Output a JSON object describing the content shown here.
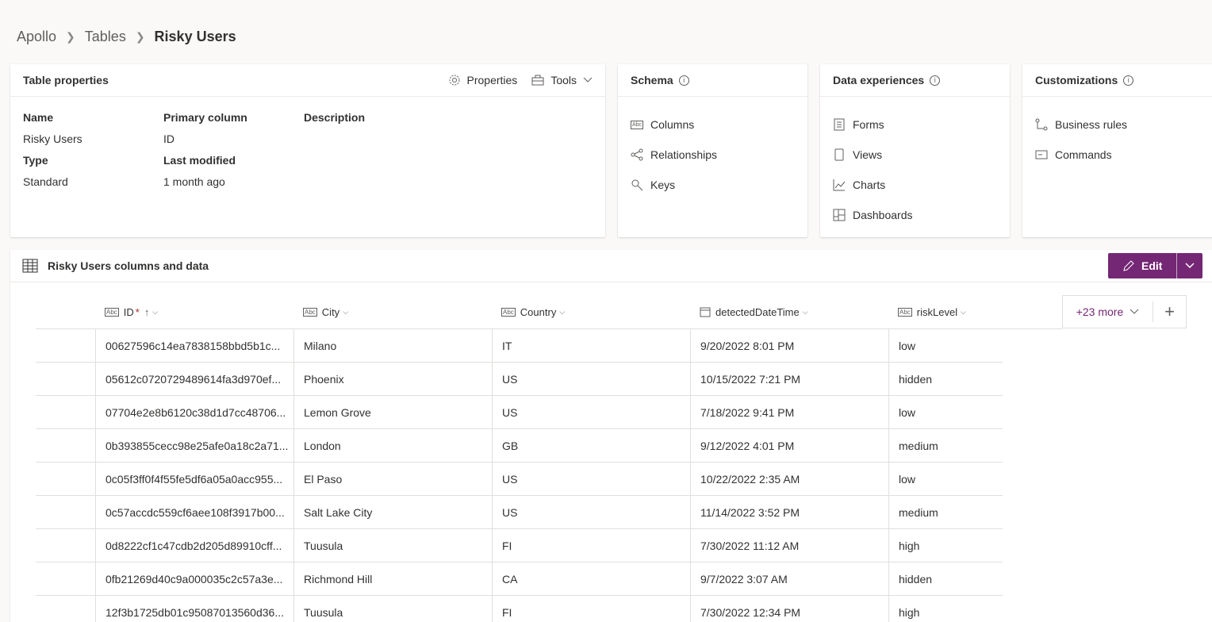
{
  "breadcrumb": {
    "items": [
      "Apollo",
      "Tables"
    ],
    "current": "Risky Users"
  },
  "table_properties": {
    "title": "Table properties",
    "properties_label": "Properties",
    "tools_label": "Tools",
    "fields": {
      "name_label": "Name",
      "name_value": "Risky Users",
      "primary_label": "Primary column",
      "primary_value": "ID",
      "description_label": "Description",
      "type_label": "Type",
      "type_value": "Standard",
      "modified_label": "Last modified",
      "modified_value": "1 month ago"
    }
  },
  "schema": {
    "title": "Schema",
    "items": [
      "Columns",
      "Relationships",
      "Keys"
    ]
  },
  "data_experiences": {
    "title": "Data experiences",
    "items": [
      "Forms",
      "Views",
      "Charts",
      "Dashboards"
    ]
  },
  "customizations": {
    "title": "Customizations",
    "items": [
      "Business rules",
      "Commands"
    ]
  },
  "data_panel": {
    "title": "Risky Users columns and data",
    "edit_label": "Edit",
    "more_label": "+23 more",
    "columns": [
      "ID",
      "City",
      "Country",
      "detectedDateTime",
      "riskLevel"
    ],
    "required_marker": "*",
    "sort_indicator": "↑",
    "rows": [
      [
        "00627596c14ea7838158bbd5b1c...",
        "Milano",
        "IT",
        "9/20/2022 8:01 PM",
        "low"
      ],
      [
        "05612c0720729489614fa3d970ef...",
        "Phoenix",
        "US",
        "10/15/2022 7:21 PM",
        "hidden"
      ],
      [
        "07704e2e8b6120c38d1d7cc48706...",
        "Lemon Grove",
        "US",
        "7/18/2022 9:41 PM",
        "low"
      ],
      [
        "0b393855cecc98e25afe0a18c2a71...",
        "London",
        "GB",
        "9/12/2022 4:01 PM",
        "medium"
      ],
      [
        "0c05f3ff0f4f55fe5df6a05a0acc955...",
        "El Paso",
        "US",
        "10/22/2022 2:35 AM",
        "low"
      ],
      [
        "0c57accdc559cf6aee108f3917b00...",
        "Salt Lake City",
        "US",
        "11/14/2022 3:52 PM",
        "medium"
      ],
      [
        "0d8222cf1c47cdb2d205d89910cff...",
        "Tuusula",
        "FI",
        "7/30/2022 11:12 AM",
        "high"
      ],
      [
        "0fb21269d40c9a000035c2c57a3e...",
        "Richmond Hill",
        "CA",
        "9/7/2022 3:07 AM",
        "hidden"
      ],
      [
        "12f3b1725db01c95087013560d36...",
        "Tuusula",
        "FI",
        "7/30/2022 12:34 PM",
        "high"
      ]
    ]
  },
  "colors": {
    "accent": "#742774"
  }
}
